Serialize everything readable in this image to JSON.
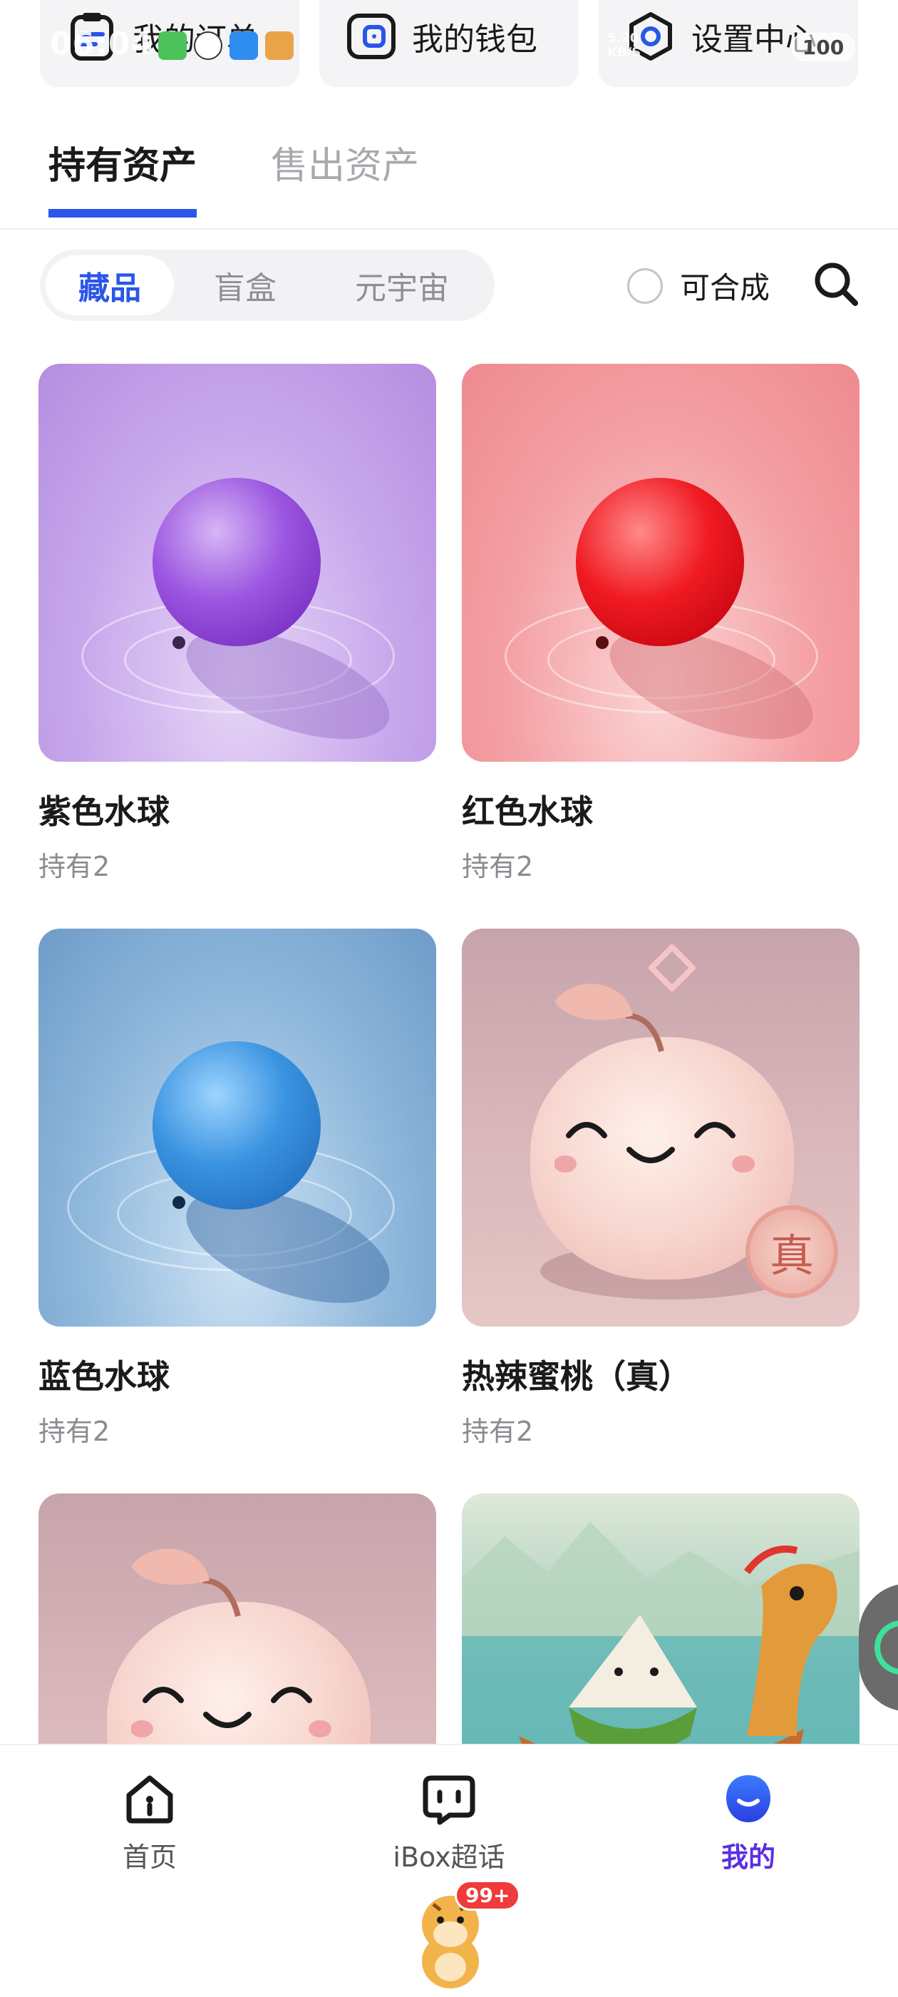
{
  "quick_actions": [
    {
      "label": "我的订单",
      "icon": "order-list-icon"
    },
    {
      "label": "我的钱包",
      "icon": "wallet-icon"
    },
    {
      "label": "设置中心",
      "icon": "settings-hex-icon"
    }
  ],
  "status_bar": {
    "time": "06:04",
    "network": "5.20\nKB/S",
    "battery": "100"
  },
  "tabs": [
    {
      "label": "持有资产",
      "active": true
    },
    {
      "label": "售出资产",
      "active": false
    }
  ],
  "segments": [
    {
      "label": "藏品",
      "active": true
    },
    {
      "label": "盲盒",
      "active": false
    },
    {
      "label": "元宇宙",
      "active": false
    }
  ],
  "filter": {
    "label": "可合成",
    "checked": false
  },
  "items": [
    {
      "name": "紫色水球",
      "hold": "持有2",
      "image": "purple-water-balloon"
    },
    {
      "name": "红色水球",
      "hold": "持有2",
      "image": "red-water-balloon"
    },
    {
      "name": "蓝色水球",
      "hold": "持有2",
      "image": "blue-water-balloon"
    },
    {
      "name": "热辣蜜桃（真）",
      "hold": "持有2",
      "image": "peach-with-zhen-badge",
      "badge": "真"
    },
    {
      "name": "",
      "hold": "",
      "image": "peach"
    },
    {
      "name": "",
      "hold": "",
      "image": "dragon-boat-zongzi"
    }
  ],
  "bottom_nav": [
    {
      "label": "首页",
      "icon": "home-icon",
      "active": false
    },
    {
      "label": "iBox超话",
      "icon": "chat-icon",
      "active": false
    },
    {
      "label": "我的",
      "icon": "profile-icon",
      "active": true
    }
  ],
  "mascot_badge": "99+",
  "colors": {
    "accent": "#2a56e8",
    "active_nav": "#5b2ee6",
    "badge_red": "#ef3b3b"
  }
}
